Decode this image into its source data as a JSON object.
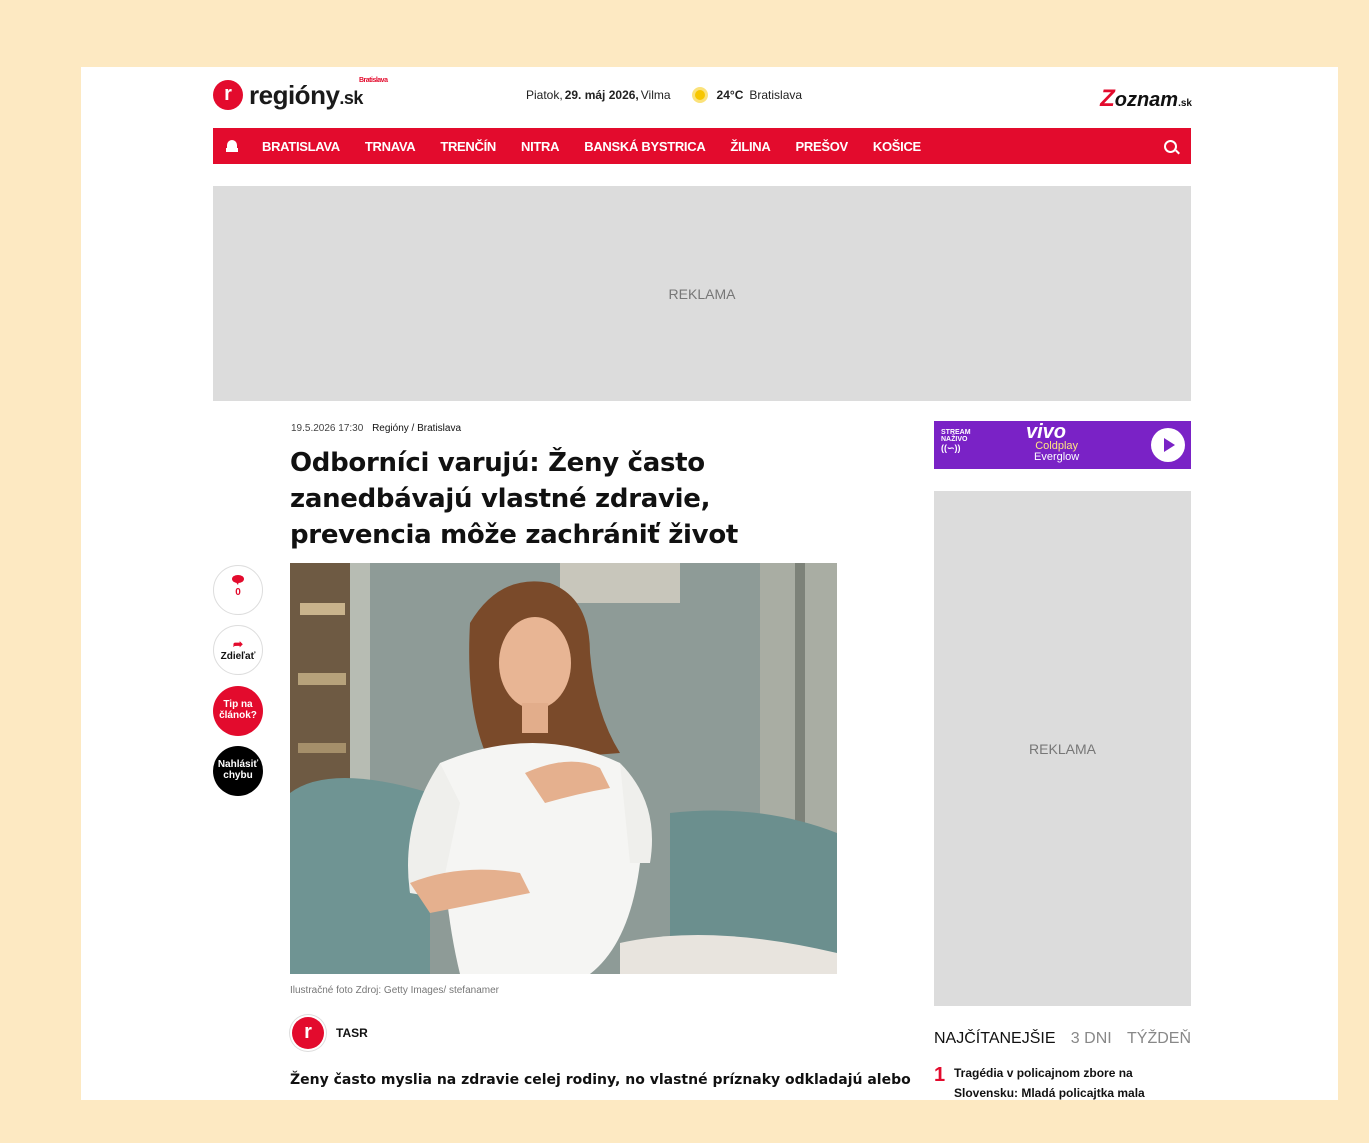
{
  "header": {
    "logo_letter": "r",
    "logo_text": "regióny",
    "logo_tld": ".sk",
    "logo_city": "Bratislava",
    "date_prefix": "Piatok,",
    "date_main": "29. máj 2026,",
    "nameday": "Vilma",
    "temperature": "24°C",
    "weather_city": "Bratislava",
    "partner_z": "Z",
    "partner_rest": "oznam",
    "partner_tld": ".sk",
    "weather_icon": "sun-icon"
  },
  "nav": {
    "items": [
      "BRATISLAVA",
      "TRNAVA",
      "TRENČÍN",
      "NITRA",
      "BANSKÁ BYSTRICA",
      "ŽILINA",
      "PREŠOV",
      "KOŠICE"
    ],
    "home_icon": "home-icon",
    "search_icon": "search-icon"
  },
  "ads": {
    "top_label": "REKLAMA",
    "side_label": "REKLAMA"
  },
  "article": {
    "datetime": "19.5.2026 17:30",
    "section": "Regióny / Bratislava",
    "title": "Odborníci varujú: Ženy často zanedbávajú vlastné zdravie, prevencia môže zachrániť život",
    "caption": "Ilustračné foto Zdroj: Getty Images/ stefanamer",
    "author_letter": "r",
    "author": "TASR",
    "lead": "Ženy často myslia na zdravie celej rodiny, no vlastné príznaky odkladajú alebo"
  },
  "actions": {
    "comments_count": "0",
    "share_label": "Zdieľať",
    "tip_label_1": "Tip na",
    "tip_label_2": "článok?",
    "report_label_1": "Nahlásiť",
    "report_label_2": "chybu"
  },
  "radio": {
    "stream_line1": "STREAM",
    "stream_line2": "NAŽIVO",
    "stream_wave": "((∽))",
    "logo": "vivo",
    "artist": "Coldplay",
    "song": "Everglow"
  },
  "popular": {
    "tabs": [
      "NAJČÍTANEJŠIE",
      "3 DNI",
      "TÝŽDEŇ"
    ],
    "items": [
      {
        "rank": "1",
        "title": "Tragédia v policajnom zbore na Slovensku: Mladá policajtka mala"
      }
    ]
  },
  "colors": {
    "accent": "#e30b2d",
    "background": "#fde9c2",
    "radio": "#7a22c6"
  }
}
